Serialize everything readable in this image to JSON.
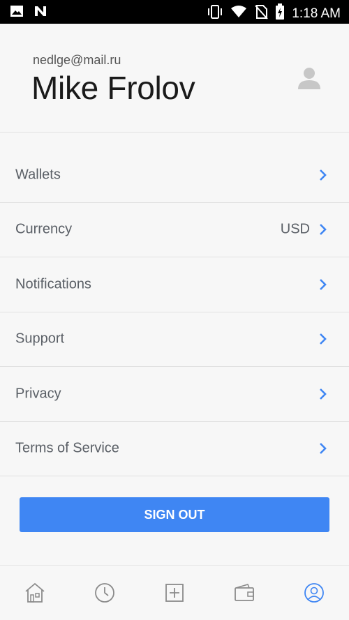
{
  "status_bar": {
    "time": "1:18 AM",
    "icons": [
      "image-icon",
      "n-app-icon",
      "vibrate-icon",
      "wifi-icon",
      "no-sim-icon",
      "battery-charging-icon"
    ]
  },
  "profile": {
    "email": "nedlge@mail.ru",
    "name": "Mike Frolov",
    "avatar_icon": "person-icon"
  },
  "menu": {
    "items": [
      {
        "label": "Wallets",
        "value": ""
      },
      {
        "label": "Currency",
        "value": "USD"
      },
      {
        "label": "Notifications",
        "value": ""
      },
      {
        "label": "Support",
        "value": ""
      },
      {
        "label": "Privacy",
        "value": ""
      },
      {
        "label": "Terms of Service",
        "value": ""
      }
    ]
  },
  "sign_out": {
    "label": "SIGN OUT"
  },
  "tabs": [
    {
      "icon": "home-icon",
      "active": false
    },
    {
      "icon": "clock-icon",
      "active": false
    },
    {
      "icon": "plus-icon",
      "active": false
    },
    {
      "icon": "wallet-icon",
      "active": false
    },
    {
      "icon": "profile-icon",
      "active": true
    }
  ],
  "colors": {
    "accent": "#3f86f3",
    "chevron": "#3f86f3",
    "text_secondary": "#5a5f66",
    "tab_inactive": "#8a8a8a"
  }
}
